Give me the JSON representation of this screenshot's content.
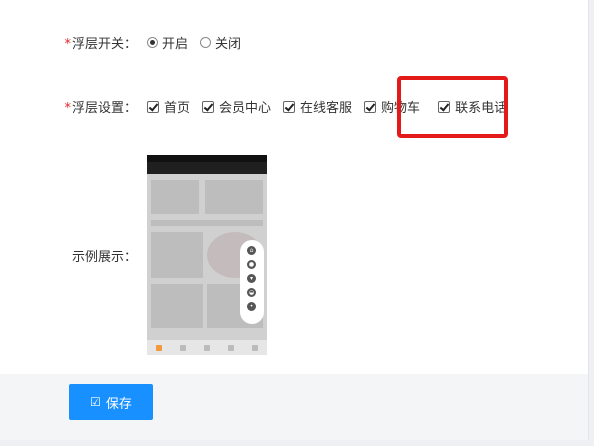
{
  "float_switch": {
    "required_mark": "*",
    "label": "浮层开关：",
    "options": [
      {
        "label": "开启",
        "selected": true
      },
      {
        "label": "关闭",
        "selected": false
      }
    ]
  },
  "float_settings": {
    "required_mark": "*",
    "label": "浮层设置：",
    "items": [
      {
        "label": "首页",
        "checked": true
      },
      {
        "label": "会员中心",
        "checked": true
      },
      {
        "label": "在线客服",
        "checked": true
      },
      {
        "label": "购物车",
        "checked": true
      },
      {
        "label": "联系电话",
        "checked": true
      }
    ],
    "highlight_color": "#e41a1a"
  },
  "example": {
    "label": "示例展示："
  },
  "actions": {
    "save_label": "保存",
    "accent": "#1890ff"
  }
}
